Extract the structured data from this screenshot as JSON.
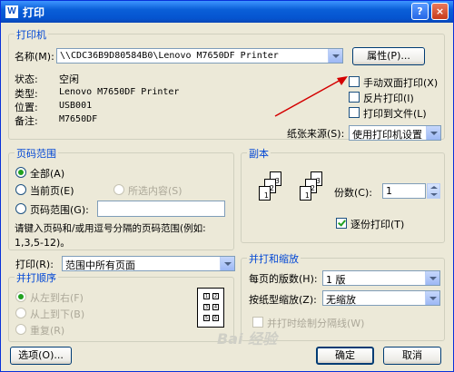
{
  "window": {
    "title": "打印",
    "title_icon": "W",
    "help_glyph": "?",
    "close_glyph": "×",
    "colors": {
      "titlebar": "#0a5fd8",
      "face": "#ece9d8",
      "group_text": "#0046d5"
    }
  },
  "printer": {
    "legend": "打印机",
    "name_label": "名称(M):",
    "name_value": "\\\\CDC36B9D80584B0\\Lenovo M7650DF Printer",
    "properties_button": "属性(P)...",
    "info_labels": [
      "状态:",
      "类型:",
      "位置:",
      "备注:"
    ],
    "info_values": [
      "空闲",
      "Lenovo M7650DF Printer",
      "USB001",
      "M7650DF"
    ],
    "manual_duplex": "手动双面打印(X)",
    "reverse_print": "反片打印(I)",
    "print_to_file": "打印到文件(L)",
    "paper_source_label": "纸张来源(S):",
    "paper_source_value": "使用打印机设置"
  },
  "page_range": {
    "legend": "页码范围",
    "all": "全部(A)",
    "current_page": "当前页(E)",
    "selection": "所选内容(S)",
    "pages": "页码范围(G):",
    "pages_value": "",
    "hint_line1": "请键入页码和/或用逗号分隔的页码范围(例如:",
    "hint_line2": "1,3,5-12)。"
  },
  "copies": {
    "legend": "副本",
    "count_label": "份数(C):",
    "count_value": "1",
    "collate": "逐份打印(T)",
    "collate_checked": true,
    "page_numbers": [
      "3",
      "2",
      "1"
    ]
  },
  "print_what": {
    "label": "打印(R):",
    "value": "范围中所有页面"
  },
  "order": {
    "legend": "并打顺序",
    "left_to_right": "从左到右(F)",
    "top_to_bottom": "从上到下(B)",
    "repeat": "重复(R)",
    "grid_numbers": [
      "1",
      "2",
      "3",
      "4",
      "5",
      "6"
    ]
  },
  "zoom": {
    "legend": "并打和缩放",
    "pages_per_sheet_label": "每页的版数(H):",
    "pages_per_sheet_value": "1 版",
    "scale_label": "按纸型缩放(Z):",
    "scale_value": "无缩放",
    "draw_borders": "并打时绘制分隔线(W)"
  },
  "footer": {
    "options_button": "选项(O)...",
    "ok_button": "确定",
    "cancel_button": "取消",
    "watermark": "Bai 经验"
  }
}
